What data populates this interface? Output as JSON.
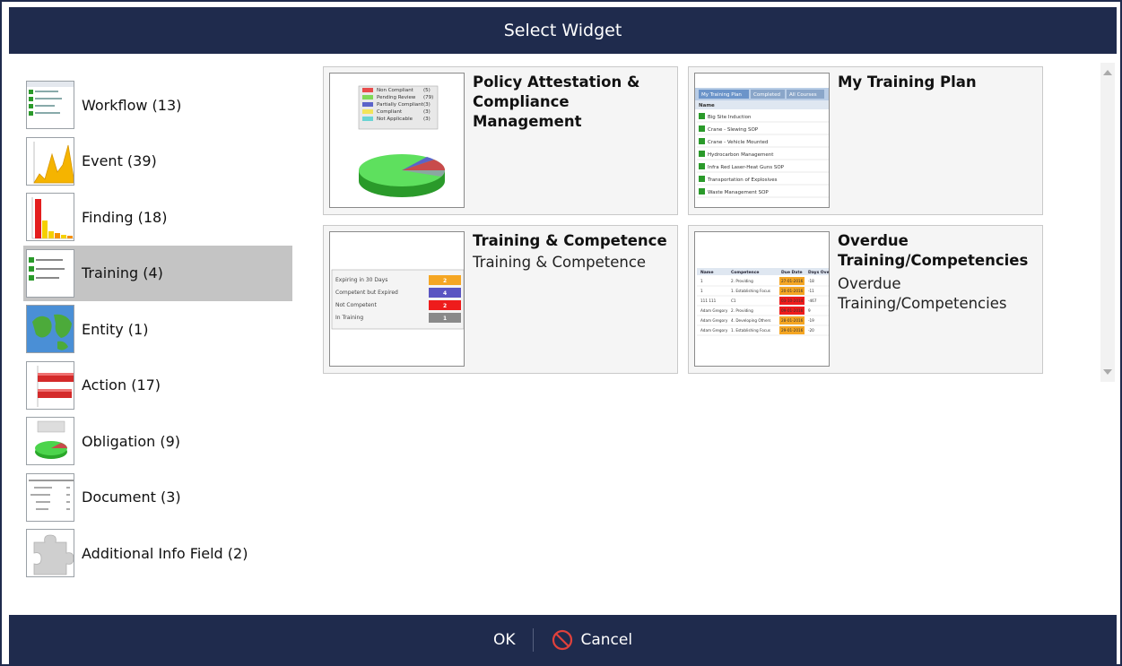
{
  "dialog": {
    "title": "Select Widget",
    "ok_label": "OK",
    "cancel_label": "Cancel"
  },
  "categories": [
    {
      "label": "Workflow (13)",
      "icon": "workflow-thumbnail"
    },
    {
      "label": "Event (39)",
      "icon": "event-area-chart-thumbnail"
    },
    {
      "label": "Finding (18)",
      "icon": "finding-bar-chart-thumbnail"
    },
    {
      "label": "Training (4)",
      "icon": "training-list-thumbnail",
      "selected": true
    },
    {
      "label": "Entity (1)",
      "icon": "entity-map-thumbnail"
    },
    {
      "label": "Action (17)",
      "icon": "action-bar-chart-thumbnail"
    },
    {
      "label": "Obligation (9)",
      "icon": "obligation-pie-thumbnail"
    },
    {
      "label": "Document (3)",
      "icon": "document-tree-thumbnail"
    },
    {
      "label": "Additional Info Field (2)",
      "icon": "puzzle-piece-thumbnail"
    }
  ],
  "widgets": [
    {
      "title": "Policy Attestation & Compliance Management",
      "description": "",
      "preview": {
        "legend": [
          "Non Compliant",
          "Pending Review",
          "Partially Compliant",
          "Compliant",
          "Not Applicable"
        ],
        "legend_counts": [
          "(5)",
          "(79)",
          "(3)",
          "(3)",
          "(3)"
        ],
        "legend_colors": [
          "#e84c4c",
          "#7fd857",
          "#5b63c9",
          "#f2e45a",
          "#6ad4d4"
        ]
      }
    },
    {
      "title": "My Training Plan",
      "description": "",
      "preview": {
        "tabs": [
          "My Training Plan",
          "Completed",
          "All Courses"
        ],
        "header": "Name",
        "rows": [
          "Big Site Induction",
          "Crane - Slewing SOP",
          "Crane - Vehicle Mounted",
          "Hydrocarbon Management",
          "Infra Red Laser-Heat Guns SOP",
          "Transportation of Explosives",
          "Waste Management SOP"
        ]
      }
    },
    {
      "title": "Training & Competence",
      "description": "Training & Competence",
      "preview": {
        "rows": [
          {
            "label": "Expiring in 30 Days",
            "value": "2",
            "color": "#f5a623"
          },
          {
            "label": "Competent but Expired",
            "value": "4",
            "color": "#5a55c2"
          },
          {
            "label": "Not Competent",
            "value": "2",
            "color": "#ee1c1c"
          },
          {
            "label": "In Training",
            "value": "1",
            "color": "#8a8a8a"
          }
        ]
      }
    },
    {
      "title": "Overdue Training/Competencies",
      "description": "Overdue Training/Competencies",
      "preview": {
        "headers": [
          "Name",
          "Competence",
          "Due Date",
          "Days Overdue"
        ],
        "rows": [
          [
            "1",
            "2. Providing",
            "27-01-2016",
            "-18"
          ],
          [
            "1",
            "1. Establishing Focus",
            "20-01-2016",
            "-11"
          ],
          [
            "111 111",
            "C1",
            "03-10-2014",
            "-467"
          ],
          [
            "Adam Gregory",
            "2. Providing",
            "09-01-2016",
            "9"
          ],
          [
            "Adam Gregory",
            "4. Developing Others",
            "28-01-2016",
            "-19"
          ],
          [
            "Adam Gregory",
            "1. Establishing Focus",
            "29-01-2016",
            "-20"
          ]
        ]
      }
    }
  ]
}
